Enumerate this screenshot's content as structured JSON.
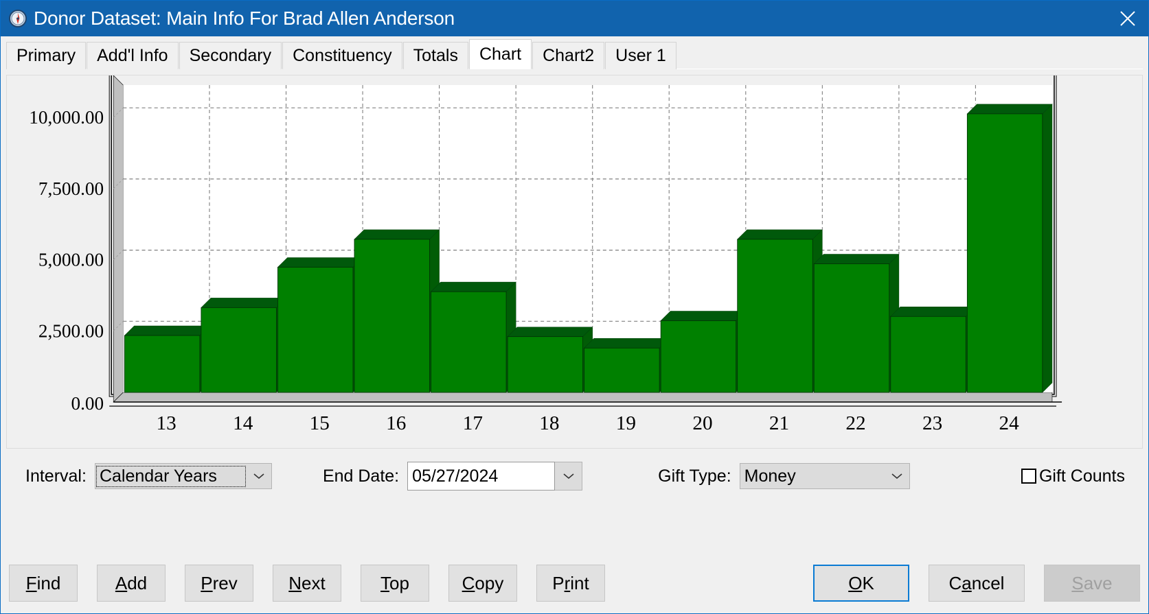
{
  "window": {
    "title": "Donor Dataset: Main Info For Brad Allen Anderson",
    "icon": "compass-icon",
    "close_label": "✕",
    "titlebar_color": "#1163ad"
  },
  "tabs": [
    {
      "label": "Primary",
      "active": false
    },
    {
      "label": "Add'l Info",
      "active": false
    },
    {
      "label": "Secondary",
      "active": false
    },
    {
      "label": "Constituency",
      "active": false
    },
    {
      "label": "Totals",
      "active": false
    },
    {
      "label": "Chart",
      "active": true
    },
    {
      "label": "Chart2",
      "active": false
    },
    {
      "label": "User 1",
      "active": false
    }
  ],
  "controls": {
    "interval_label": "Interval:",
    "interval_value": "Calendar Years",
    "end_date_label": "End Date:",
    "end_date_value": "05/27/2024",
    "gift_type_label": "Gift Type:",
    "gift_type_value": "Money",
    "gift_counts_label": "Gift Counts",
    "gift_counts_checked": false,
    "dropdown_icon": "chevron-down-icon"
  },
  "buttons": {
    "left": [
      {
        "label": "Find",
        "accesskey": "F",
        "name": "find-button"
      },
      {
        "label": "Add",
        "accesskey": "A",
        "name": "add-button"
      },
      {
        "label": "Prev",
        "accesskey": "P",
        "name": "prev-button"
      },
      {
        "label": "Next",
        "accesskey": "N",
        "name": "next-button"
      },
      {
        "label": "Top",
        "accesskey": "T",
        "name": "top-button"
      },
      {
        "label": "Copy",
        "accesskey": "C",
        "name": "copy-button"
      },
      {
        "label": "Print",
        "accesskey": "r",
        "name": "print-button"
      }
    ],
    "right": [
      {
        "label": "OK",
        "accesskey": "O",
        "name": "ok-button",
        "focused": true,
        "disabled": false
      },
      {
        "label": "Cancel",
        "accesskey": "a",
        "name": "cancel-button",
        "focused": false,
        "disabled": false
      },
      {
        "label": "Save",
        "accesskey": "S",
        "name": "save-button",
        "focused": false,
        "disabled": true
      }
    ]
  },
  "chart_data": {
    "type": "bar",
    "title": "",
    "xlabel": "",
    "ylabel": "",
    "categories": [
      "13",
      "14",
      "15",
      "16",
      "17",
      "18",
      "19",
      "20",
      "21",
      "22",
      "23",
      "24"
    ],
    "values": [
      2000,
      2980,
      4400,
      5380,
      3540,
      1960,
      1560,
      2520,
      5380,
      4520,
      2670,
      9790
    ],
    "ytick_labels": [
      "10,000.00",
      "7,500.00",
      "5,000.00",
      "2,500.00",
      "0.00"
    ],
    "ytick_values": [
      10000,
      7500,
      5000,
      2500,
      0
    ],
    "ylim": [
      0,
      10800
    ],
    "grid": true,
    "legend": "none",
    "bar_color": "#008000",
    "bar_top_color": "#00590b",
    "bar_side_color": "#015c06",
    "plot_bg": "#ffffff",
    "wall_color": "#c0c0c0"
  }
}
